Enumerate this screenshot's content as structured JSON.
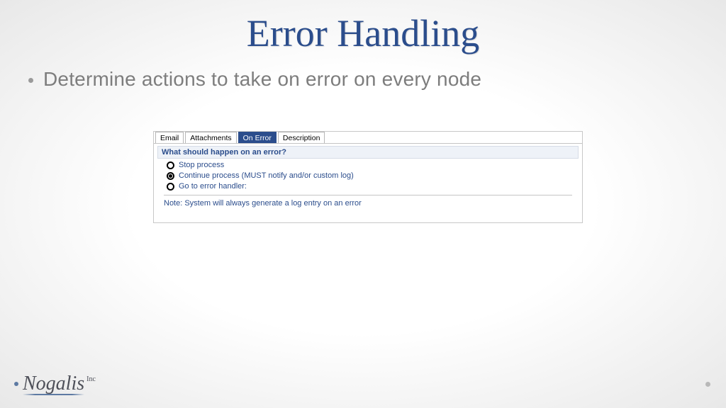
{
  "title": "Error Handling",
  "bullet": "Determine actions to take on error on every node",
  "panel": {
    "tabs": [
      "Email",
      "Attachments",
      "On Error",
      "Description"
    ],
    "active_tab_index": 2,
    "section_heading": "What should happen on an error?",
    "options": [
      {
        "label": "Stop process",
        "checked": false
      },
      {
        "label": "Continue process (MUST notify and/or custom log)",
        "checked": true
      },
      {
        "label": "Go to error handler:",
        "checked": false
      }
    ],
    "note": "Note: System will always generate a log entry on an error"
  },
  "logo": {
    "name": "Nogalis",
    "suffix": "Inc"
  }
}
